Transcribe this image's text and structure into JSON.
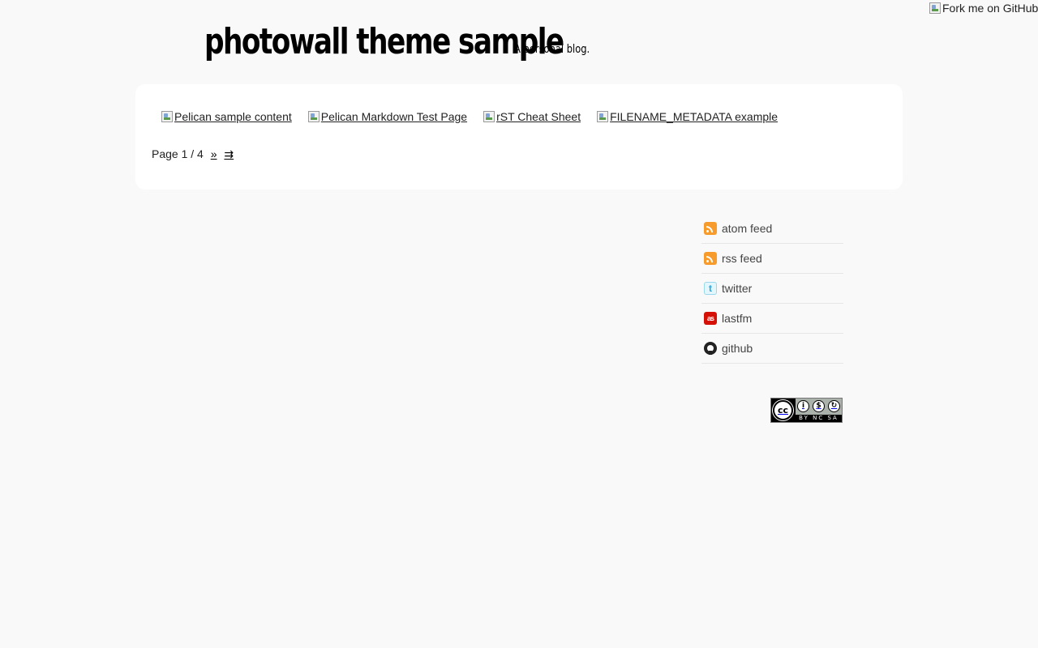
{
  "fork_ribbon": {
    "alt": "Fork me on GitHub"
  },
  "header": {
    "title": "photowall theme sample",
    "tagline": "A personal blog."
  },
  "photos": [
    {
      "alt": "Pelican sample content"
    },
    {
      "alt": "Pelican Markdown Test Page"
    },
    {
      "alt": "rST Cheat Sheet"
    },
    {
      "alt": "FILENAME_METADATA example"
    }
  ],
  "pagination": {
    "text": "Page 1 / 4",
    "next": "»",
    "last": "⇉"
  },
  "sidebar": {
    "social": [
      {
        "label": "atom feed",
        "icon": "rss-icon"
      },
      {
        "label": "rss feed",
        "icon": "rss-icon"
      },
      {
        "label": "twitter",
        "icon": "twitter-icon"
      },
      {
        "label": "lastfm",
        "icon": "lastfm-icon"
      },
      {
        "label": "github",
        "icon": "github-icon"
      }
    ]
  },
  "license": {
    "badge_text": "BY NC SA"
  },
  "colors": {
    "background": "#f9f9f9",
    "card": "#ffffff",
    "rss": "#f79b2d",
    "lastfm": "#d51007",
    "twitter": "#2aa9e0"
  }
}
